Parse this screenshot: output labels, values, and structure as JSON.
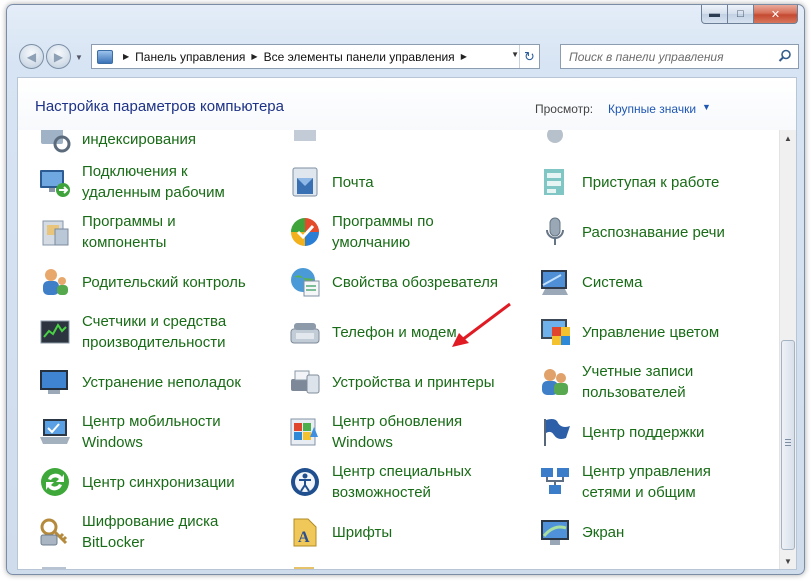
{
  "window": {
    "caption_minimize": "▬",
    "caption_maximize": "□",
    "caption_close": "✕"
  },
  "navbar": {
    "back_glyph": "◀",
    "forward_glyph": "▶",
    "address_segments": [
      "Панель управления",
      "Все элементы панели управления"
    ],
    "separator_glyph": "▶",
    "dropdown_glyph": "▼",
    "refresh_glyph": "↻",
    "search_placeholder": "Поиск в панели управления"
  },
  "header": {
    "title": "Настройка параметров компьютера",
    "view_label": "Просмотр:",
    "view_value": "Крупные значки",
    "view_arrow": "▼"
  },
  "items": [
    {
      "label": "индексирования",
      "icon": "indexing-icon"
    },
    {
      "label": "Подключения к удаленным рабочим",
      "icon": "remote-desktop-icon"
    },
    {
      "label": "Почта",
      "icon": "mail-icon"
    },
    {
      "label": "Приступая к работе",
      "icon": "getting-started-icon"
    },
    {
      "label": "Программы и компоненты",
      "icon": "programs-features-icon"
    },
    {
      "label": "Программы по умолчанию",
      "icon": "default-programs-icon"
    },
    {
      "label": "Распознавание речи",
      "icon": "microphone-icon"
    },
    {
      "label": "Родительский контроль",
      "icon": "parental-controls-icon"
    },
    {
      "label": "Свойства обозревателя",
      "icon": "internet-options-icon"
    },
    {
      "label": "Система",
      "icon": "system-icon"
    },
    {
      "label": "Счетчики и средства производительности",
      "icon": "performance-icon"
    },
    {
      "label": "Телефон и модем",
      "icon": "phone-modem-icon"
    },
    {
      "label": "Управление цветом",
      "icon": "color-management-icon"
    },
    {
      "label": "Устранение неполадок",
      "icon": "troubleshooting-icon"
    },
    {
      "label": "Устройства и принтеры",
      "icon": "devices-printers-icon"
    },
    {
      "label": "Учетные записи пользователей",
      "icon": "user-accounts-icon"
    },
    {
      "label": "Центр мобильности Windows",
      "icon": "mobility-center-icon"
    },
    {
      "label": "Центр обновления Windows",
      "icon": "windows-update-icon"
    },
    {
      "label": "Центр поддержки",
      "icon": "action-center-flag-icon"
    },
    {
      "label": "Центр синхронизации",
      "icon": "sync-center-icon"
    },
    {
      "label": "Центр специальных возможностей",
      "icon": "ease-of-access-icon"
    },
    {
      "label": "Центр управления сетями и общим",
      "icon": "network-center-icon"
    },
    {
      "label": "Шифрование диска BitLocker",
      "icon": "bitlocker-icon"
    },
    {
      "label": "Шрифты",
      "icon": "fonts-icon"
    },
    {
      "label": "Экран",
      "icon": "display-icon"
    }
  ],
  "scrollbar": {
    "up_glyph": "▲",
    "down_glyph": "▼",
    "position_fraction": 0.62
  },
  "annotation": {
    "arrow_color": "#e01b24"
  }
}
